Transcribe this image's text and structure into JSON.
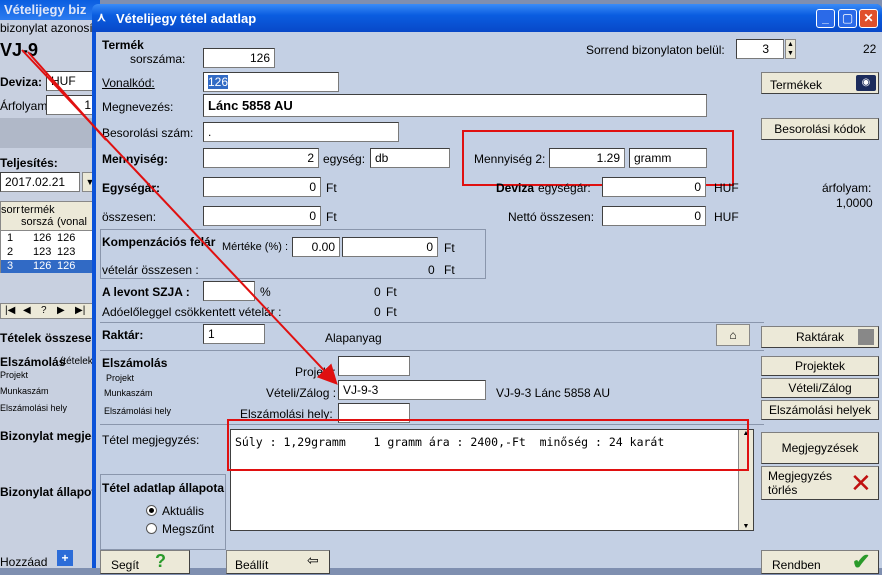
{
  "background_window": {
    "title": "Vételijegy biz",
    "id_label": "bizonylat azonosító",
    "id_value": "VJ-9",
    "currency_label": "Deviza:",
    "currency_value": "HUF",
    "rate_label": "Árfolyam:",
    "rate_value": "1",
    "fulfillment_label": "Teljesítés:",
    "fulfillment_date": "2017.02.21",
    "grid_headers": [
      "sorr",
      "termék sorszá",
      "(vonal"
    ],
    "grid_rows": [
      {
        "n": "1",
        "a": "126",
        "b": "126"
      },
      {
        "n": "2",
        "a": "123",
        "b": "123"
      },
      {
        "n": "3",
        "a": "126",
        "b": "126"
      }
    ],
    "items_total_label": "Tételek összesen",
    "settlement_label": "Elszámolás",
    "settlement_sub": "(tételek",
    "project_label": "Projekt",
    "worknumber_label": "Munkaszám",
    "settlement_place_label": "Elszámolási hely",
    "doc_note_label": "Bizonylat megjegyzés",
    "doc_state_label": "Bizonylat állapota",
    "add_label": "Hozzáad"
  },
  "dialog": {
    "title": "Vételijegy tétel adatlap",
    "counter": "22",
    "product": {
      "header": "Termék",
      "serial_label": "sorszáma:",
      "serial_value": "126",
      "barcode_label": "Vonalkód:",
      "barcode_value": "126",
      "name_label": "Megnevezés:",
      "name_value": "Lánc 5858 AU",
      "classification_label": "Besorolási szám:",
      "classification_value": "."
    },
    "order_label": "Sorrend bizonylaton belül:",
    "order_value": "3",
    "quantity": {
      "label": "Mennyiség:",
      "value": "2",
      "unit_label": "egység:",
      "unit_value": "db",
      "q2_label": "Mennyiség 2:",
      "q2_value": "1.29",
      "q2_unit": "gramm"
    },
    "unit_price": {
      "label": "Egységár:",
      "value": "0",
      "currency": "Ft",
      "total_label": "összesen:",
      "total_value": "0",
      "total_currency": "Ft"
    },
    "foreign": {
      "label": "Deviza",
      "unit_label": "egységár:",
      "unit_value": "0",
      "currency": "HUF",
      "rate_label": "árfolyam:",
      "rate_value": "1,0000",
      "net_label": "Nettó összesen:",
      "net_value": "0",
      "net_currency": "HUF"
    },
    "compensation": {
      "label": "Kompenzációs felár",
      "rate_label": "Mértéke (%) :",
      "rate_value": "0.00",
      "amount_value": "0",
      "amount_currency": "Ft",
      "total_label": "vételár összesen :",
      "total_value": "0",
      "total_currency": "Ft"
    },
    "szja": {
      "label": "A levont SZJA :",
      "unit": "%",
      "value": "0",
      "currency": "Ft"
    },
    "advance_label": "Adóelőleggel csökkentett vételár :",
    "advance_value": "0",
    "advance_currency": "Ft",
    "warehouse": {
      "label": "Raktár:",
      "value": "1",
      "name": "Alapanyag"
    },
    "settlement": {
      "header": "Elszámolás",
      "project_small": "Projekt",
      "worknumber_small": "Munkaszám",
      "place_small": "Elszámolási hely",
      "project_label": "Projekt:",
      "project_value": "",
      "purchase_label": "Vételi/Zálog :",
      "purchase_value": "VJ-9-3",
      "purchase_desc": "VJ-9-3 Lánc 5858 AU",
      "place_label": "Elszámolási hely:",
      "place_value": ""
    },
    "note": {
      "label": "Tétel megjegyzés:",
      "text": "Súly : 1,29gramm    1 gramm ára : 2400,-Ft  minőség : 24 karát"
    },
    "state": {
      "label": "Tétel adatlap állapota",
      "current": "Aktuális",
      "ceased": "Megszűnt"
    },
    "buttons": {
      "products": "Termékek",
      "classification_codes": "Besorolási kódok",
      "warehouses": "Raktárak",
      "projects": "Projektek",
      "purchase": "Vételi/Zálog",
      "settlement_places": "Elszámolási helyek",
      "notes": "Megjegyzések",
      "note_delete": "Megjegyzés törlés",
      "help": "Segít",
      "reset": "Beállít",
      "ok": "Rendben"
    }
  },
  "colors": {
    "titlebar": "#0a5de0",
    "client": "#c4d0e4",
    "highlight": "#e01010",
    "selection": "#316ac5"
  }
}
